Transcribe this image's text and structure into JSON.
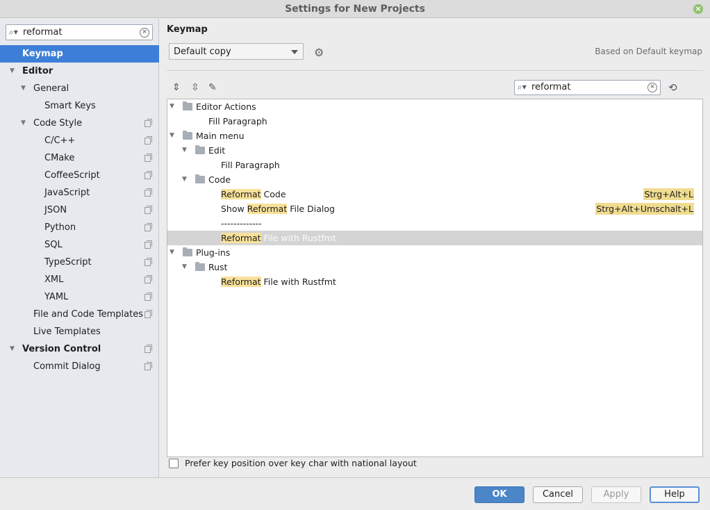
{
  "window": {
    "title": "Settings for New Projects"
  },
  "sidebar": {
    "search_value": "reformat",
    "items": [
      {
        "label": "Keymap"
      },
      {
        "label": "Editor"
      },
      {
        "label": "General"
      },
      {
        "label": "Smart Keys"
      },
      {
        "label": "Code Style"
      },
      {
        "label": "C/C++"
      },
      {
        "label": "CMake"
      },
      {
        "label": "CoffeeScript"
      },
      {
        "label": "JavaScript"
      },
      {
        "label": "JSON"
      },
      {
        "label": "Python"
      },
      {
        "label": "SQL"
      },
      {
        "label": "TypeScript"
      },
      {
        "label": "XML"
      },
      {
        "label": "YAML"
      },
      {
        "label": "File and Code Templates"
      },
      {
        "label": "Live Templates"
      },
      {
        "label": "Version Control"
      },
      {
        "label": "Commit Dialog"
      }
    ]
  },
  "main": {
    "title": "Keymap",
    "keymap_value": "Default copy",
    "based_on": "Based on Default keymap",
    "search_value": "reformat",
    "tree": {
      "editor_actions": "Editor Actions",
      "fill_paragraph_1": "Fill Paragraph",
      "main_menu": "Main menu",
      "edit": "Edit",
      "fill_paragraph_2": "Fill Paragraph",
      "code": "Code",
      "reformat_code": {
        "hl": "Reformat",
        "rest": " Code",
        "shortcut": "Strg+Alt+L"
      },
      "show_reformat": {
        "pre": "Show ",
        "hl": "Reformat",
        "rest": " File Dialog",
        "shortcut": "Strg+Alt+Umschalt+L"
      },
      "separator": "-------------",
      "reformat_rustfmt_1": {
        "hl": "Reformat",
        "rest": " File with Rustfmt"
      },
      "plugins": "Plug-ins",
      "rust": "Rust",
      "reformat_rustfmt_2": {
        "hl": "Reformat",
        "rest": " File with Rustfmt"
      }
    },
    "checkbox_label": "Prefer key position over key char with national layout"
  },
  "buttons": {
    "ok": "OK",
    "cancel": "Cancel",
    "apply": "Apply",
    "help": "Help"
  }
}
